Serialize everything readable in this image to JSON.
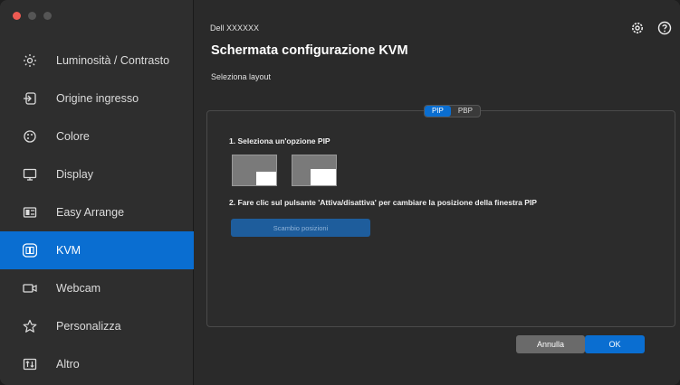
{
  "sidebar": {
    "items": [
      {
        "label": "Luminosità / Contrasto",
        "icon": "brightness-icon"
      },
      {
        "label": "Origine ingresso",
        "icon": "input-source-icon"
      },
      {
        "label": "Colore",
        "icon": "color-icon"
      },
      {
        "label": "Display",
        "icon": "display-icon"
      },
      {
        "label": "Easy Arrange",
        "icon": "easy-arrange-icon"
      },
      {
        "label": "KVM",
        "icon": "kvm-icon",
        "active": true
      },
      {
        "label": "Webcam",
        "icon": "webcam-icon"
      },
      {
        "label": "Personalizza",
        "icon": "star-icon"
      },
      {
        "label": "Altro",
        "icon": "other-icon"
      }
    ]
  },
  "header": {
    "model": "Dell XXXXXX",
    "title": "Schermata configurazione KVM",
    "subtitle": "Seleziona layout"
  },
  "layout_tabs": [
    "PIP",
    "PBP"
  ],
  "selected_tab": "PIP",
  "step1": "1. Seleziona un'opzione PIP",
  "step2": "2. Fare clic sul pulsante 'Attiva/disattiva' per cambiare la posizione della finestra PIP",
  "swap_button": "Scambio posizioni",
  "buttons": {
    "cancel": "Annulla",
    "ok": "OK"
  },
  "colors": {
    "accent": "#0a6ed1",
    "sidebar_bg": "#2e2e2e",
    "main_bg": "#2a2a2a"
  }
}
